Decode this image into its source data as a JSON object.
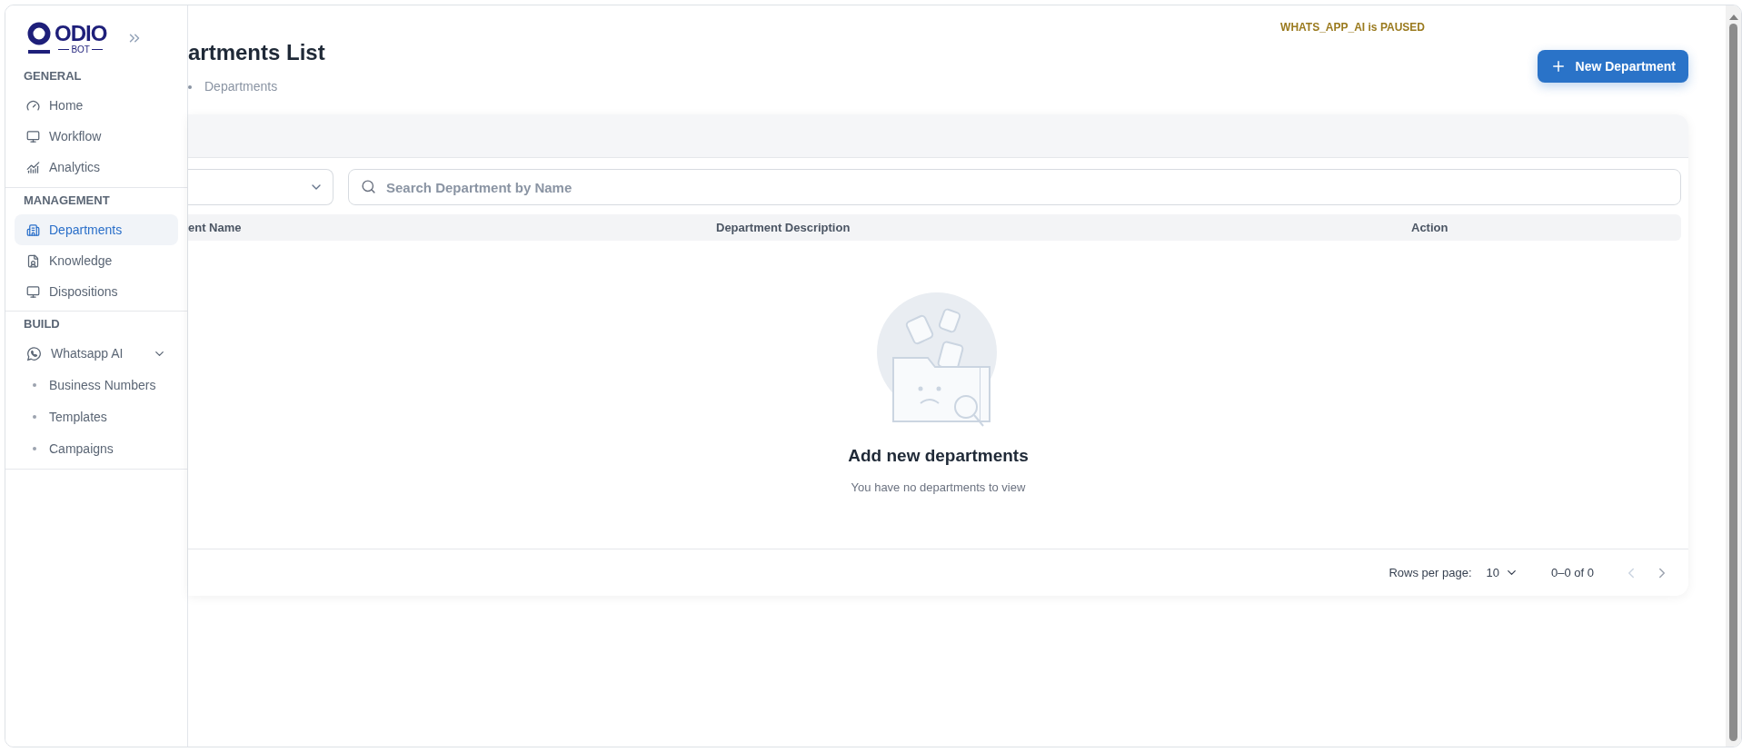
{
  "sidebar": {
    "logo": {
      "name": "ODIO",
      "tagline": "BOT"
    },
    "sections": [
      {
        "title": "GENERAL",
        "items": [
          {
            "label": "Home",
            "selected": false
          },
          {
            "label": "Workflow",
            "selected": false
          },
          {
            "label": "Analytics",
            "selected": false
          }
        ]
      },
      {
        "title": "MANAGEMENT",
        "items": [
          {
            "label": "Departments",
            "selected": true
          },
          {
            "label": "Knowledge",
            "selected": false
          },
          {
            "label": "Dispositions",
            "selected": false
          }
        ]
      },
      {
        "title": "BUILD",
        "items": [
          {
            "label": "Whatsapp AI",
            "selected": false,
            "expanded": true,
            "children": [
              {
                "label": "Business Numbers",
                "selected": false
              },
              {
                "label": "Templates",
                "selected": false
              },
              {
                "label": "Campaigns",
                "selected": false
              }
            ]
          }
        ]
      }
    ]
  },
  "status_banner": "WHATS_APP_AI is PAUSED",
  "page": {
    "title": "artments List",
    "breadcrumb": [
      "Departments"
    ],
    "new_button": "New Department"
  },
  "search": {
    "placeholder": "Search Department by Name"
  },
  "table": {
    "columns": [
      "ent Name",
      "Department Description",
      "Action"
    ]
  },
  "empty_state": {
    "title": "Add new departments",
    "subtitle": "You have no departments to view"
  },
  "pagination": {
    "rows_per_page_label": "Rows per page:",
    "rows_per_page": "10",
    "range": "0–0 of 0",
    "prev_disabled": true,
    "next_disabled": false
  }
}
